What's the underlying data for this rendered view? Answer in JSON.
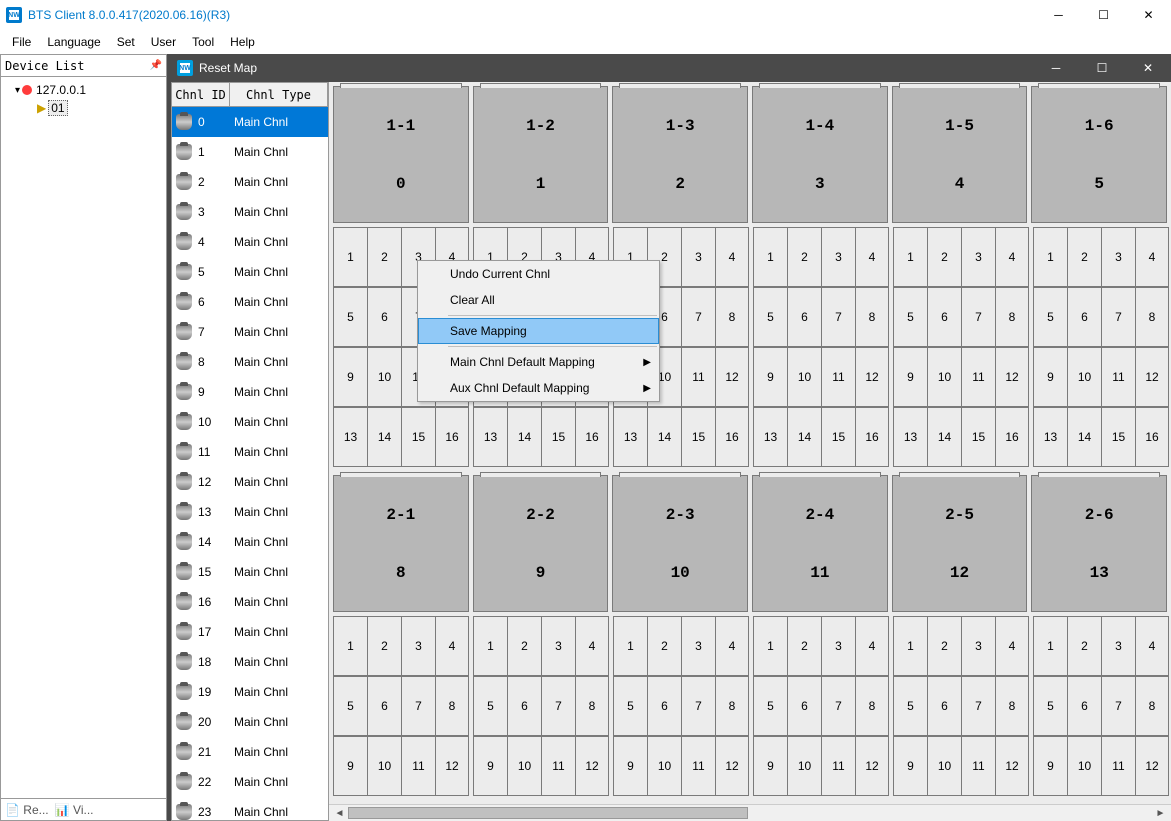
{
  "main_window": {
    "title": "BTS Client 8.0.0.417(2020.06.16)(R3)",
    "logo_text": "NW"
  },
  "menu": {
    "file": "File",
    "language": "Language",
    "set": "Set",
    "user": "User",
    "tool": "Tool",
    "help": "Help"
  },
  "sidebar": {
    "title": "Device List",
    "node_ip": "127.0.0.1",
    "node_child": "01",
    "bottom_left": "Re...",
    "bottom_right": "Vi..."
  },
  "inner_window": {
    "title": "Reset Map"
  },
  "chnl_list": {
    "col1": "Chnl ID",
    "col2": "Chnl Type",
    "rows": [
      {
        "id": "0",
        "type": "Main Chnl",
        "sel": true
      },
      {
        "id": "1",
        "type": "Main Chnl"
      },
      {
        "id": "2",
        "type": "Main Chnl"
      },
      {
        "id": "3",
        "type": "Main Chnl"
      },
      {
        "id": "4",
        "type": "Main Chnl"
      },
      {
        "id": "5",
        "type": "Main Chnl"
      },
      {
        "id": "6",
        "type": "Main Chnl"
      },
      {
        "id": "7",
        "type": "Main Chnl"
      },
      {
        "id": "8",
        "type": "Main Chnl"
      },
      {
        "id": "9",
        "type": "Main Chnl"
      },
      {
        "id": "10",
        "type": "Main Chnl"
      },
      {
        "id": "11",
        "type": "Main Chnl"
      },
      {
        "id": "12",
        "type": "Main Chnl"
      },
      {
        "id": "13",
        "type": "Main Chnl"
      },
      {
        "id": "14",
        "type": "Main Chnl"
      },
      {
        "id": "15",
        "type": "Main Chnl"
      },
      {
        "id": "16",
        "type": "Main Chnl"
      },
      {
        "id": "17",
        "type": "Main Chnl"
      },
      {
        "id": "18",
        "type": "Main Chnl"
      },
      {
        "id": "19",
        "type": "Main Chnl"
      },
      {
        "id": "20",
        "type": "Main Chnl"
      },
      {
        "id": "21",
        "type": "Main Chnl"
      },
      {
        "id": "22",
        "type": "Main Chnl"
      },
      {
        "id": "23",
        "type": "Main Chnl"
      }
    ]
  },
  "map": {
    "big_rows": [
      {
        "blocks": [
          {
            "label": "1-1",
            "num": "0"
          },
          {
            "label": "1-2",
            "num": "1"
          },
          {
            "label": "1-3",
            "num": "2"
          },
          {
            "label": "1-4",
            "num": "3"
          },
          {
            "label": "1-5",
            "num": "4"
          },
          {
            "label": "1-6",
            "num": "5"
          }
        ]
      },
      {
        "blocks": [
          {
            "label": "2-1",
            "num": "8"
          },
          {
            "label": "2-2",
            "num": "9"
          },
          {
            "label": "2-3",
            "num": "10"
          },
          {
            "label": "2-4",
            "num": "11"
          },
          {
            "label": "2-5",
            "num": "12"
          },
          {
            "label": "2-6",
            "num": "13"
          }
        ]
      }
    ],
    "small_rows_pattern": [
      [
        "1",
        "2",
        "3",
        "4"
      ],
      [
        "5",
        "6",
        "7",
        "8"
      ],
      [
        "9",
        "10",
        "11",
        "12"
      ],
      [
        "13",
        "14",
        "15",
        "16"
      ]
    ],
    "small_rows_pattern2": [
      [
        "1",
        "2",
        "3",
        "4"
      ],
      [
        "5",
        "6",
        "7",
        "8"
      ],
      [
        "9",
        "10",
        "11",
        "12"
      ]
    ]
  },
  "context_menu": {
    "items": [
      {
        "label": "Undo Current Chnl",
        "arrow": false,
        "hover": false
      },
      {
        "label": "Clear All",
        "arrow": false,
        "hover": false
      },
      {
        "sep": true
      },
      {
        "label": "Save Mapping",
        "arrow": false,
        "hover": true
      },
      {
        "sep": true
      },
      {
        "label": "Main Chnl Default Mapping",
        "arrow": true,
        "hover": false
      },
      {
        "label": "Aux Chnl Default Mapping",
        "arrow": true,
        "hover": false
      }
    ]
  }
}
